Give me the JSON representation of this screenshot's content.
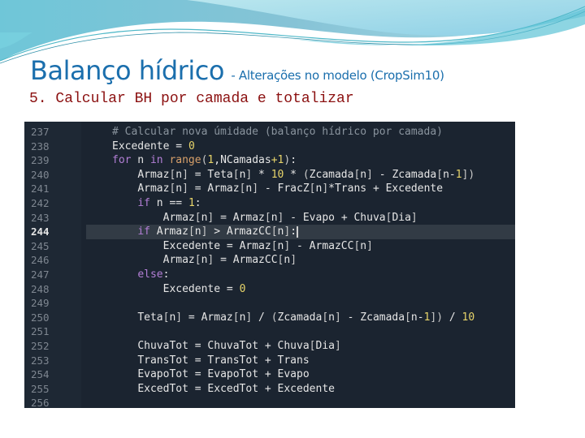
{
  "slide": {
    "title": "Balanço hídrico",
    "title_suffix": "- Alterações no modelo (CropSim10)",
    "subtitle": "5. Calcular BH por camada e totalizar",
    "colors": {
      "title": "#1b6fad",
      "subtitle": "#8b1010",
      "editor_bg": "#1b2430",
      "active_line_bg": "#323b45"
    }
  },
  "editor": {
    "active_line": 244,
    "lines": [
      {
        "num": "237",
        "indent": 1,
        "tokens": [
          {
            "t": "cm",
            "v": "# Calcular nova úmidade (balanço hídrico por camada)"
          }
        ]
      },
      {
        "num": "238",
        "indent": 1,
        "tokens": [
          {
            "t": "id",
            "v": "Excedente "
          },
          {
            "t": "op",
            "v": "= "
          },
          {
            "t": "num",
            "v": "0"
          }
        ]
      },
      {
        "num": "239",
        "indent": 1,
        "tokens": [
          {
            "t": "kw",
            "v": "for"
          },
          {
            "t": "id",
            "v": " n "
          },
          {
            "t": "kw",
            "v": "in"
          },
          {
            "t": "id",
            "v": " "
          },
          {
            "t": "fn",
            "v": "range"
          },
          {
            "t": "br",
            "v": "("
          },
          {
            "t": "num",
            "v": "1"
          },
          {
            "t": "id",
            "v": ",NCamadas"
          },
          {
            "t": "num",
            "v": "+1"
          },
          {
            "t": "br",
            "v": ")"
          },
          {
            "t": "op",
            "v": ":"
          }
        ]
      },
      {
        "num": "240",
        "indent": 2,
        "tokens": [
          {
            "t": "id",
            "v": "Armaz"
          },
          {
            "t": "br",
            "v": "["
          },
          {
            "t": "id",
            "v": "n"
          },
          {
            "t": "br",
            "v": "]"
          },
          {
            "t": "op",
            "v": " = "
          },
          {
            "t": "id",
            "v": "Teta"
          },
          {
            "t": "br",
            "v": "["
          },
          {
            "t": "id",
            "v": "n"
          },
          {
            "t": "br",
            "v": "]"
          },
          {
            "t": "op",
            "v": " * "
          },
          {
            "t": "num",
            "v": "10"
          },
          {
            "t": "op",
            "v": " * "
          },
          {
            "t": "br",
            "v": "("
          },
          {
            "t": "id",
            "v": "Zcamada"
          },
          {
            "t": "br",
            "v": "["
          },
          {
            "t": "id",
            "v": "n"
          },
          {
            "t": "br",
            "v": "]"
          },
          {
            "t": "op",
            "v": " - "
          },
          {
            "t": "id",
            "v": "Zcamada"
          },
          {
            "t": "br",
            "v": "["
          },
          {
            "t": "id",
            "v": "n-"
          },
          {
            "t": "num",
            "v": "1"
          },
          {
            "t": "br",
            "v": "])"
          }
        ]
      },
      {
        "num": "241",
        "indent": 2,
        "tokens": [
          {
            "t": "id",
            "v": "Armaz"
          },
          {
            "t": "br",
            "v": "["
          },
          {
            "t": "id",
            "v": "n"
          },
          {
            "t": "br",
            "v": "]"
          },
          {
            "t": "op",
            "v": " = "
          },
          {
            "t": "id",
            "v": "Armaz"
          },
          {
            "t": "br",
            "v": "["
          },
          {
            "t": "id",
            "v": "n"
          },
          {
            "t": "br",
            "v": "]"
          },
          {
            "t": "op",
            "v": " - "
          },
          {
            "t": "id",
            "v": "FracZ"
          },
          {
            "t": "br",
            "v": "["
          },
          {
            "t": "id",
            "v": "n"
          },
          {
            "t": "br",
            "v": "]"
          },
          {
            "t": "op",
            "v": "*"
          },
          {
            "t": "id",
            "v": "Trans "
          },
          {
            "t": "op",
            "v": "+ "
          },
          {
            "t": "id",
            "v": "Excedente"
          }
        ]
      },
      {
        "num": "242",
        "indent": 2,
        "tokens": [
          {
            "t": "kw",
            "v": "if"
          },
          {
            "t": "id",
            "v": " n "
          },
          {
            "t": "op",
            "v": "== "
          },
          {
            "t": "num",
            "v": "1"
          },
          {
            "t": "op",
            "v": ":"
          }
        ]
      },
      {
        "num": "243",
        "indent": 3,
        "tokens": [
          {
            "t": "id",
            "v": "Armaz"
          },
          {
            "t": "br",
            "v": "["
          },
          {
            "t": "id",
            "v": "n"
          },
          {
            "t": "br",
            "v": "]"
          },
          {
            "t": "op",
            "v": " = "
          },
          {
            "t": "id",
            "v": "Armaz"
          },
          {
            "t": "br",
            "v": "["
          },
          {
            "t": "id",
            "v": "n"
          },
          {
            "t": "br",
            "v": "]"
          },
          {
            "t": "op",
            "v": " - "
          },
          {
            "t": "id",
            "v": "Evapo "
          },
          {
            "t": "op",
            "v": "+ "
          },
          {
            "t": "id",
            "v": "Chuva"
          },
          {
            "t": "br",
            "v": "["
          },
          {
            "t": "id",
            "v": "Dia"
          },
          {
            "t": "br",
            "v": "]"
          }
        ]
      },
      {
        "num": "244",
        "indent": 2,
        "tokens": [
          {
            "t": "kw",
            "v": "if"
          },
          {
            "t": "id",
            "v": " Armaz"
          },
          {
            "t": "br",
            "v": "["
          },
          {
            "t": "id",
            "v": "n"
          },
          {
            "t": "br",
            "v": "]"
          },
          {
            "t": "op",
            "v": " > "
          },
          {
            "t": "id",
            "v": "ArmazCC"
          },
          {
            "t": "br",
            "v": "["
          },
          {
            "t": "id",
            "v": "n"
          },
          {
            "t": "br",
            "v": "]"
          },
          {
            "t": "op",
            "v": ":"
          },
          {
            "t": "cur",
            "v": ""
          }
        ]
      },
      {
        "num": "245",
        "indent": 3,
        "tokens": [
          {
            "t": "id",
            "v": "Excedente "
          },
          {
            "t": "op",
            "v": "= "
          },
          {
            "t": "id",
            "v": "Armaz"
          },
          {
            "t": "br",
            "v": "["
          },
          {
            "t": "id",
            "v": "n"
          },
          {
            "t": "br",
            "v": "]"
          },
          {
            "t": "op",
            "v": " - "
          },
          {
            "t": "id",
            "v": "ArmazCC"
          },
          {
            "t": "br",
            "v": "["
          },
          {
            "t": "id",
            "v": "n"
          },
          {
            "t": "br",
            "v": "]"
          }
        ]
      },
      {
        "num": "246",
        "indent": 3,
        "tokens": [
          {
            "t": "id",
            "v": "Armaz"
          },
          {
            "t": "br",
            "v": "["
          },
          {
            "t": "id",
            "v": "n"
          },
          {
            "t": "br",
            "v": "]"
          },
          {
            "t": "op",
            "v": " = "
          },
          {
            "t": "id",
            "v": "ArmazCC"
          },
          {
            "t": "br",
            "v": "["
          },
          {
            "t": "id",
            "v": "n"
          },
          {
            "t": "br",
            "v": "]"
          }
        ]
      },
      {
        "num": "247",
        "indent": 2,
        "tokens": [
          {
            "t": "kw",
            "v": "else"
          },
          {
            "t": "op",
            "v": ":"
          }
        ]
      },
      {
        "num": "248",
        "indent": 3,
        "tokens": [
          {
            "t": "id",
            "v": "Excedente "
          },
          {
            "t": "op",
            "v": "= "
          },
          {
            "t": "num",
            "v": "0"
          }
        ]
      },
      {
        "num": "249",
        "indent": 0,
        "tokens": []
      },
      {
        "num": "250",
        "indent": 2,
        "tokens": [
          {
            "t": "id",
            "v": "Teta"
          },
          {
            "t": "br",
            "v": "["
          },
          {
            "t": "id",
            "v": "n"
          },
          {
            "t": "br",
            "v": "]"
          },
          {
            "t": "op",
            "v": " = "
          },
          {
            "t": "id",
            "v": "Armaz"
          },
          {
            "t": "br",
            "v": "["
          },
          {
            "t": "id",
            "v": "n"
          },
          {
            "t": "br",
            "v": "]"
          },
          {
            "t": "op",
            "v": " / "
          },
          {
            "t": "br",
            "v": "("
          },
          {
            "t": "id",
            "v": "Zcamada"
          },
          {
            "t": "br",
            "v": "["
          },
          {
            "t": "id",
            "v": "n"
          },
          {
            "t": "br",
            "v": "]"
          },
          {
            "t": "op",
            "v": " - "
          },
          {
            "t": "id",
            "v": "Zcamada"
          },
          {
            "t": "br",
            "v": "["
          },
          {
            "t": "id",
            "v": "n-"
          },
          {
            "t": "num",
            "v": "1"
          },
          {
            "t": "br",
            "v": "])"
          },
          {
            "t": "op",
            "v": " / "
          },
          {
            "t": "num",
            "v": "10"
          }
        ]
      },
      {
        "num": "251",
        "indent": 0,
        "tokens": []
      },
      {
        "num": "252",
        "indent": 2,
        "tokens": [
          {
            "t": "id",
            "v": "ChuvaTot "
          },
          {
            "t": "op",
            "v": "= "
          },
          {
            "t": "id",
            "v": "ChuvaTot "
          },
          {
            "t": "op",
            "v": "+ "
          },
          {
            "t": "id",
            "v": "Chuva"
          },
          {
            "t": "br",
            "v": "["
          },
          {
            "t": "id",
            "v": "Dia"
          },
          {
            "t": "br",
            "v": "]"
          }
        ]
      },
      {
        "num": "253",
        "indent": 2,
        "tokens": [
          {
            "t": "id",
            "v": "TransTot "
          },
          {
            "t": "op",
            "v": "= "
          },
          {
            "t": "id",
            "v": "TransTot "
          },
          {
            "t": "op",
            "v": "+ "
          },
          {
            "t": "id",
            "v": "Trans"
          }
        ]
      },
      {
        "num": "254",
        "indent": 2,
        "tokens": [
          {
            "t": "id",
            "v": "EvapoTot "
          },
          {
            "t": "op",
            "v": "= "
          },
          {
            "t": "id",
            "v": "EvapoTot "
          },
          {
            "t": "op",
            "v": "+ "
          },
          {
            "t": "id",
            "v": "Evapo"
          }
        ]
      },
      {
        "num": "255",
        "indent": 2,
        "tokens": [
          {
            "t": "id",
            "v": "ExcedTot "
          },
          {
            "t": "op",
            "v": "= "
          },
          {
            "t": "id",
            "v": "ExcedTot "
          },
          {
            "t": "op",
            "v": "+ "
          },
          {
            "t": "id",
            "v": "Excedente"
          }
        ]
      },
      {
        "num": "256",
        "indent": 0,
        "tokens": []
      }
    ]
  }
}
